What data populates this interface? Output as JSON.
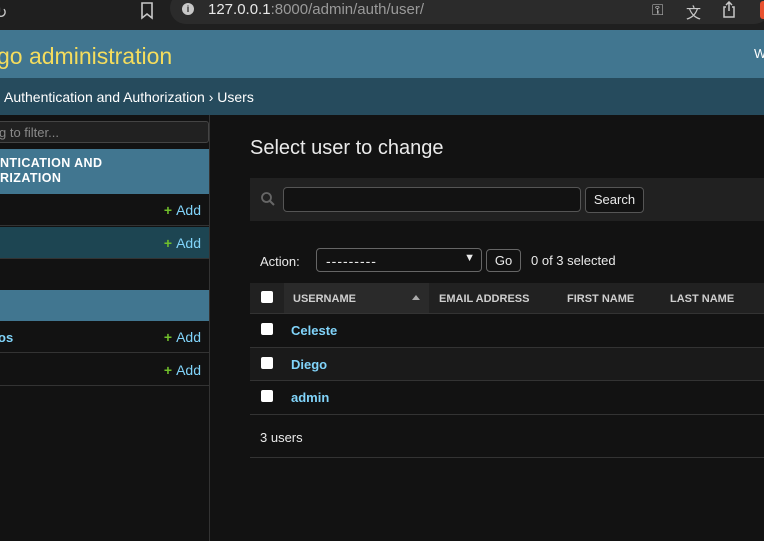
{
  "browser": {
    "url_host": "127.0.0.1",
    "url_path": ":8000/admin/auth/user/"
  },
  "header": {
    "branding": "go administration",
    "welcome": "W"
  },
  "breadcrumbs": "Authentication and Authorization › Users",
  "sidebar": {
    "filter_placeholder": "g to filter...",
    "modules": [
      {
        "caption_line1": "NTICATION AND",
        "caption_line2": "RIZATION",
        "models": [
          {
            "name": "",
            "add": "Add",
            "current": false
          },
          {
            "name": "",
            "add": "Add",
            "current": true
          }
        ]
      },
      {
        "caption": "",
        "models": [
          {
            "name": "os",
            "add": "Add"
          },
          {
            "name": "",
            "add": "Add"
          }
        ]
      }
    ]
  },
  "main": {
    "title": "Select user to change",
    "search_button": "Search",
    "action_label": "Action:",
    "action_select_value": "---------",
    "go_button": "Go",
    "selected_count": "0 of 3 selected",
    "columns": [
      "USERNAME",
      "EMAIL ADDRESS",
      "FIRST NAME",
      "LAST NAME"
    ],
    "rows": [
      {
        "username": "Celeste"
      },
      {
        "username": "Diego"
      },
      {
        "username": "admin"
      }
    ],
    "result_count": "3 users"
  },
  "colors": {
    "header": "#417690",
    "branding": "#f5dd5d",
    "breadcrumbs": "#264b5d",
    "link": "#81d4fa",
    "add_plus": "#70bf2b"
  }
}
